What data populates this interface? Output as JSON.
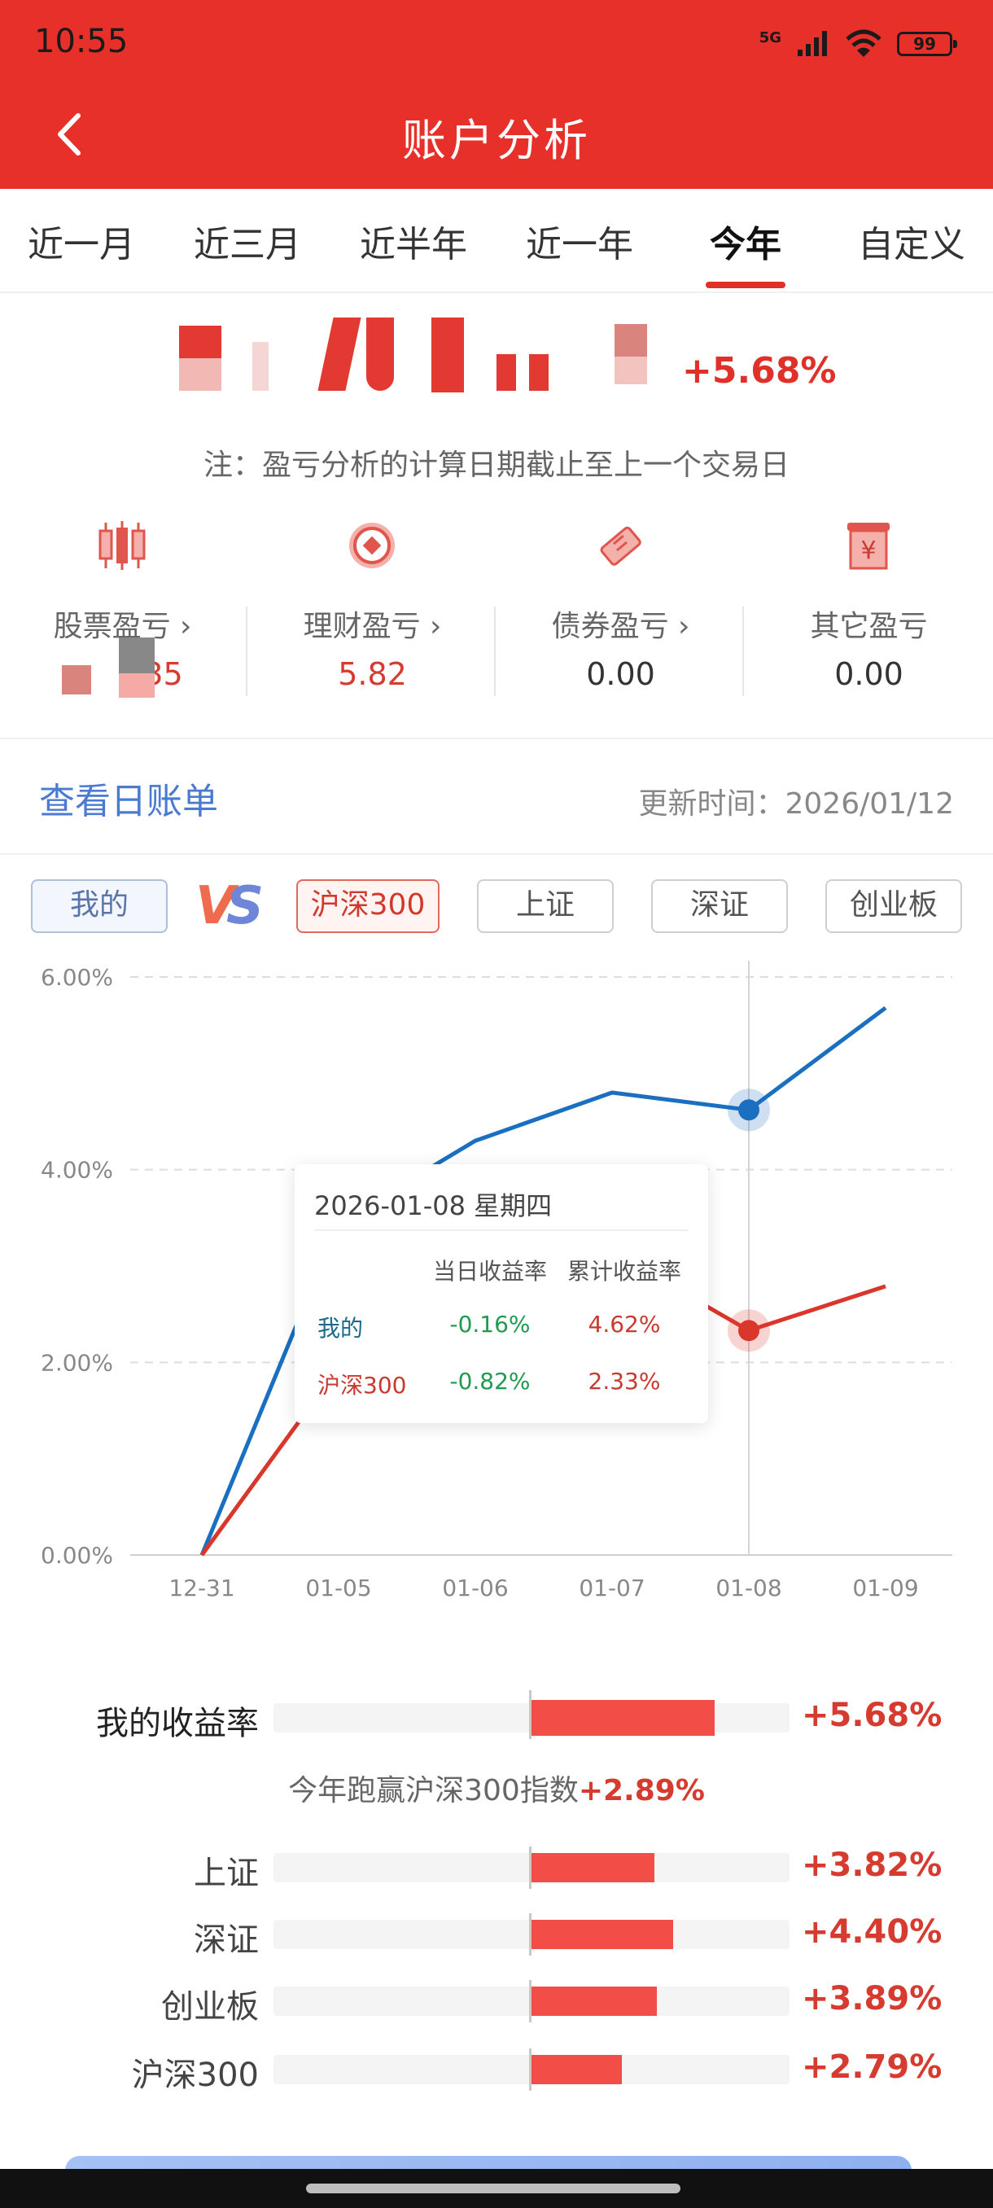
{
  "status": {
    "time": "10:55",
    "network": "5G",
    "battery": "99"
  },
  "header": {
    "title": "账户分析"
  },
  "tabs": [
    "近一月",
    "近三月",
    "近半年",
    "近一年",
    "今年",
    "自定义"
  ],
  "summary": {
    "total_pct": "+5.68%",
    "note": "注：盈亏分析的计算日期截止至上一个交易日"
  },
  "categories": [
    {
      "label": "股票盈亏",
      "value": "35",
      "icon": "candlestick-icon"
    },
    {
      "label": "理财盈亏",
      "value": "5.82",
      "icon": "coin-icon"
    },
    {
      "label": "债券盈亏",
      "value": "0.00",
      "icon": "ticket-icon"
    },
    {
      "label": "其它盈亏",
      "value": "0.00",
      "icon": "yen-calendar-icon"
    }
  ],
  "daily_bill": {
    "link": "查看日账单",
    "update_label": "更新时间：2026/01/12"
  },
  "compare": {
    "mine": "我的",
    "options": [
      "沪深300",
      "上证",
      "深证",
      "创业板"
    ]
  },
  "chart_data": {
    "type": "line",
    "x": [
      "12-31",
      "01-05",
      "01-06",
      "01-07",
      "01-08",
      "01-09"
    ],
    "y_ticks": [
      "0.00%",
      "2.00%",
      "4.00%",
      "6.00%"
    ],
    "ylim": [
      0,
      6
    ],
    "series": [
      {
        "name": "我的",
        "color": "#1a6fc0",
        "values": [
          0.0,
          3.45,
          4.3,
          4.8,
          4.62,
          5.68
        ]
      },
      {
        "name": "沪深300",
        "color": "#d9362c",
        "values": [
          0.0,
          1.95,
          3.45,
          3.15,
          2.33,
          2.79
        ]
      }
    ],
    "highlight_index": 4,
    "grid": true
  },
  "tooltip": {
    "date": "2026-01-08 星期四",
    "col1": "当日收益率",
    "col2": "累计收益率",
    "rows": [
      {
        "name": "我的",
        "daily": "-0.16%",
        "cum": "4.62%",
        "color": "#1a6a8c"
      },
      {
        "name": "沪深300",
        "daily": "-0.82%",
        "cum": "2.33%",
        "color": "#c83a30"
      }
    ]
  },
  "returns": {
    "mine": {
      "label": "我的收益率",
      "value": "+5.68%",
      "pct": 5.68
    },
    "beat_text": "今年跑赢沪深300指数",
    "beat_value": "+2.89%",
    "indices": [
      {
        "label": "上证",
        "value": "+3.82%",
        "pct": 3.82
      },
      {
        "label": "深证",
        "value": "+4.40%",
        "pct": 4.4
      },
      {
        "label": "创业板",
        "value": "+3.89%",
        "pct": 3.89
      },
      {
        "label": "沪深300",
        "value": "+2.79%",
        "pct": 2.79
      }
    ]
  }
}
